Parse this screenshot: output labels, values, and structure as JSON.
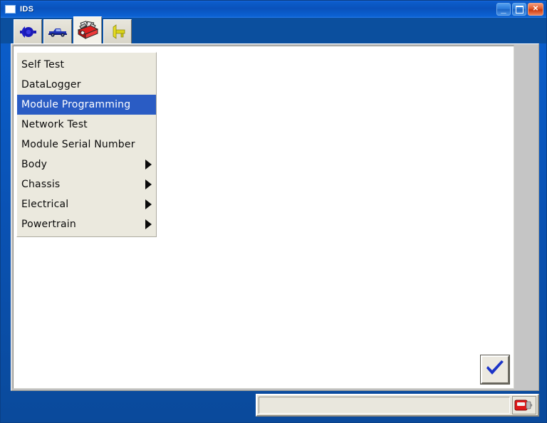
{
  "window": {
    "title": "IDS",
    "title_icon": "app-window-icon",
    "controls": [
      {
        "name": "minimize",
        "glyph": "_"
      },
      {
        "name": "maximize",
        "glyph": ""
      },
      {
        "name": "close",
        "glyph": "✕"
      }
    ]
  },
  "tabs": [
    {
      "id": "vehicle-connect",
      "icon": "connector-plug-icon",
      "active": false
    },
    {
      "id": "vehicle-identification",
      "icon": "pickup-truck-icon",
      "active": false
    },
    {
      "id": "toolbox",
      "icon": "red-toolbox-icon",
      "active": true
    },
    {
      "id": "key-programming",
      "icon": "yellow-key-icon",
      "active": false
    }
  ],
  "menu": {
    "items": [
      {
        "label": "Self Test",
        "submenu": false,
        "selected": false
      },
      {
        "label": "DataLogger",
        "submenu": false,
        "selected": false
      },
      {
        "label": "Module Programming",
        "submenu": false,
        "selected": true
      },
      {
        "label": "Network Test",
        "submenu": false,
        "selected": false
      },
      {
        "label": "Module Serial Number",
        "submenu": false,
        "selected": false
      },
      {
        "label": "Body",
        "submenu": true,
        "selected": false
      },
      {
        "label": "Chassis",
        "submenu": true,
        "selected": false
      },
      {
        "label": "Electrical",
        "submenu": true,
        "selected": false
      },
      {
        "label": "Powertrain",
        "submenu": true,
        "selected": false
      }
    ]
  },
  "actions": {
    "confirm_icon": "blue-checkmark-icon"
  },
  "statusbar": {
    "message": "",
    "device_icon": "vcm-module-icon"
  },
  "colors": {
    "titlebar_blue": "#0b5ccb",
    "frame_blue": "#0a4a9b",
    "tabstrip_blue": "#0b4f9e",
    "menu_background": "#ebe9de",
    "selection_blue": "#2a5cc4",
    "close_red": "#c8390f",
    "checkmark_blue": "#1c34c8",
    "toolbox_red": "#d81f1f",
    "truck_blue": "#1f33b4",
    "key_yellow": "#d8d014"
  }
}
